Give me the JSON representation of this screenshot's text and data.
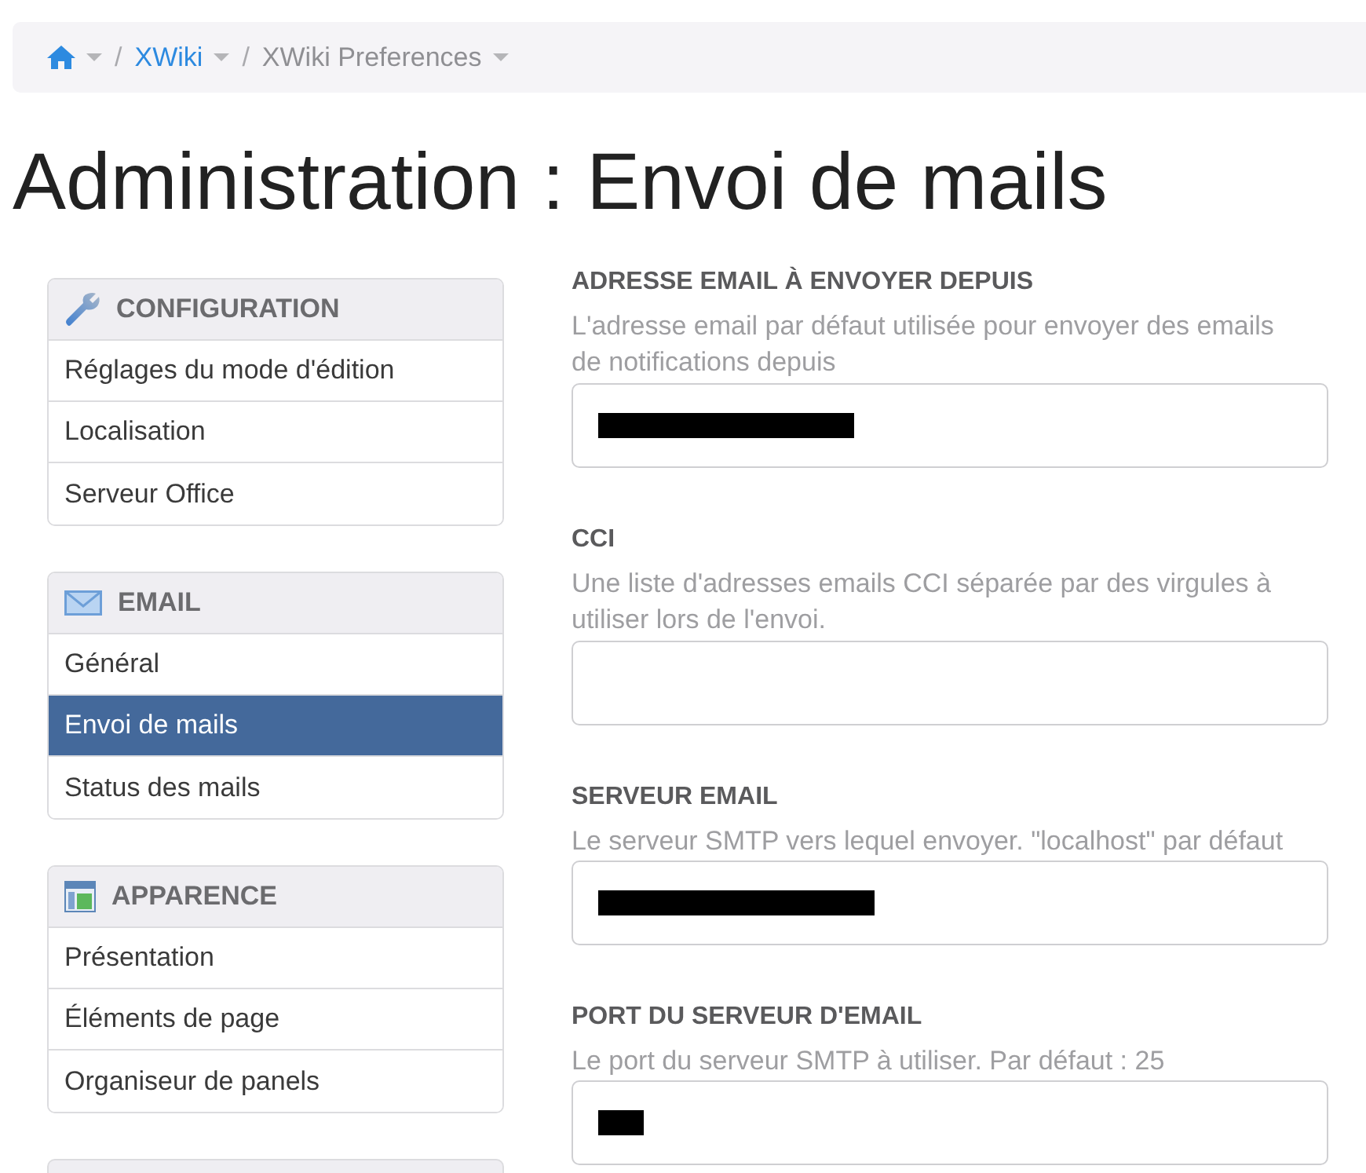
{
  "breadcrumb": [
    {
      "kind": "home",
      "current": false,
      "dropdown": true
    },
    {
      "kind": "page",
      "separator": "/",
      "label": "XWiki",
      "current": false,
      "dropdown": true
    },
    {
      "kind": "page",
      "separator": "/",
      "label": "XWiki Preferences",
      "current": true,
      "dropdown": true
    }
  ],
  "title": "Administration : Envoi de mails",
  "sidebar": {
    "panels": [
      {
        "title": "CONFIGURATION",
        "items": [
          {
            "label": "Réglages du mode d'édition",
            "selected": false
          },
          {
            "label": "Localisation",
            "selected": false
          },
          {
            "label": "Serveur Office",
            "selected": false
          }
        ]
      },
      {
        "title": "EMAIL",
        "items": [
          {
            "label": "Général",
            "selected": false
          },
          {
            "label": "Envoi de mails",
            "selected": true
          },
          {
            "label": "Status des mails",
            "selected": false
          }
        ]
      },
      {
        "title": "APPARENCE",
        "items": [
          {
            "label": "Présentation",
            "selected": false
          },
          {
            "label": "Éléments de page",
            "selected": false
          },
          {
            "label": "Organiseur de panels",
            "selected": false
          }
        ]
      }
    ],
    "more_below": true
  },
  "form": {
    "fields": [
      {
        "label": "ADRESSE EMAIL À ENVOYER DEPUIS",
        "hint": "L'adresse email par défaut utilisée pour envoyer des emails de notifications depuis",
        "redacted": true
      },
      {
        "label": "CCI",
        "hint": "Une liste d'adresses emails CCI séparée par des virgules à utiliser lors de l'envoi.",
        "redacted": false
      },
      {
        "label": "SERVEUR EMAIL",
        "hint": "Le serveur SMTP vers lequel envoyer. \"localhost\" par défaut",
        "redacted": true
      },
      {
        "label": "PORT DU SERVEUR D'EMAIL",
        "hint": "Le port du serveur SMTP à utiliser. Par défaut : 25",
        "redacted": true
      }
    ]
  }
}
